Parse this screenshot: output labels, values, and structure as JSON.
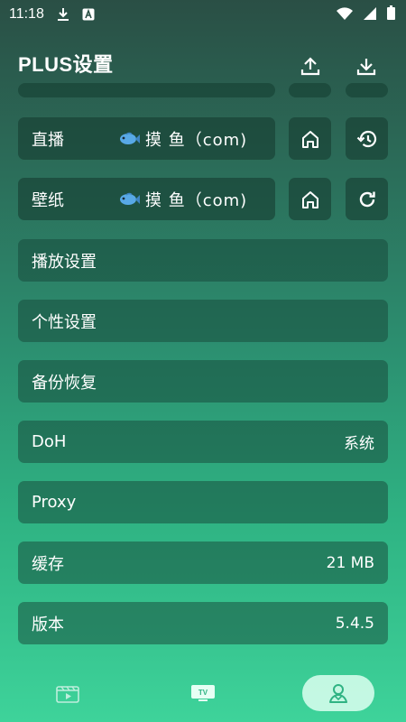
{
  "status": {
    "time": "11:18"
  },
  "header": {
    "title": "PLUS设置"
  },
  "sources": [
    {
      "label": "直播",
      "value": "摸 鱼（com)"
    },
    {
      "label": "壁纸",
      "value": "摸 鱼（com)"
    }
  ],
  "menu": [
    {
      "label": "播放设置",
      "value": ""
    },
    {
      "label": "个性设置",
      "value": ""
    },
    {
      "label": "备份恢复",
      "value": ""
    },
    {
      "label": "DoH",
      "value": "系统"
    },
    {
      "label": "Proxy",
      "value": ""
    },
    {
      "label": "缓存",
      "value": "21 MB"
    },
    {
      "label": "版本",
      "value": "5.4.5"
    }
  ],
  "tabs": {
    "tv_label": "TV"
  },
  "colors": {
    "accent": "#3ed39a",
    "fish": "#58a9e6"
  }
}
